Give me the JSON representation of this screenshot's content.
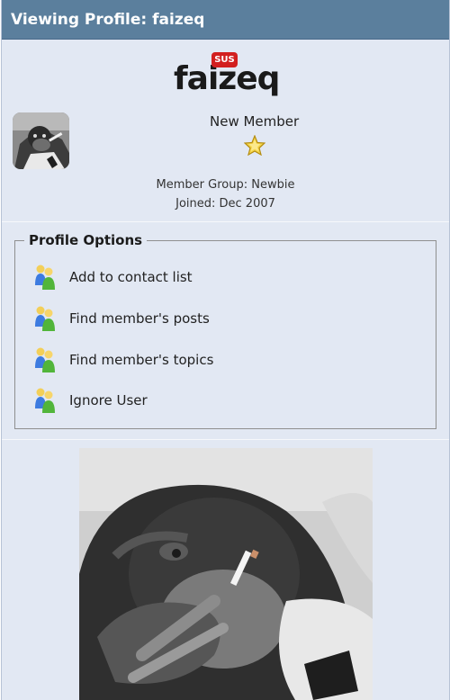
{
  "title_bar": {
    "title": "Viewing Profile: faizeq"
  },
  "profile": {
    "username": "faizeq",
    "badge": "SUS",
    "rank": "New Member",
    "member_group": "Member Group: Newbie",
    "joined": "Joined: Dec 2007"
  },
  "options": {
    "legend": "Profile Options",
    "items": [
      {
        "label": "Add to contact list",
        "icon": "people-icon"
      },
      {
        "label": "Find member's posts",
        "icon": "people-icon"
      },
      {
        "label": "Find member's topics",
        "icon": "people-icon"
      },
      {
        "label": "Ignore User",
        "icon": "people-icon"
      }
    ]
  },
  "colors": {
    "title_bar": "#5b7f9d",
    "page_background": "#e2e8f3",
    "badge": "#d21f1f",
    "star": "#f2cf2e"
  }
}
